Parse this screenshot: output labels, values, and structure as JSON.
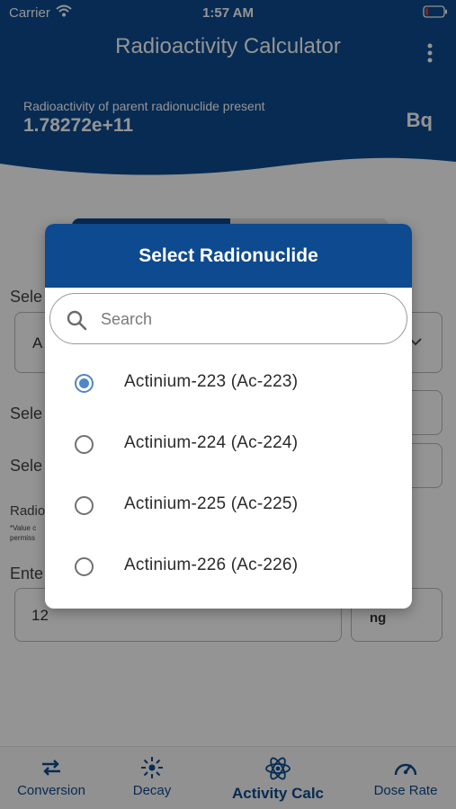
{
  "status_bar": {
    "carrier": "Carrier",
    "time": "1:57 AM"
  },
  "header": {
    "title": "Radioactivity Calculator",
    "result_label": "Radioactivity of parent radionuclide present",
    "result_value": "1.78272e+11",
    "result_unit": "Bq"
  },
  "background_form": {
    "label_1": "Sele",
    "field_1_value": "A",
    "label_2": "Sele",
    "label_3": "Sele",
    "radio_label": "Radio",
    "note_line1": "*Value c",
    "note_line2": "permiss",
    "enter_label": "Ente",
    "amount_value": "12",
    "unit_value": "ng"
  },
  "dialog": {
    "title": "Select Radionuclide",
    "search_placeholder": "Search",
    "options": [
      {
        "label": "Actinium-223 (Ac-223)",
        "selected": true
      },
      {
        "label": "Actinium-224 (Ac-224)",
        "selected": false
      },
      {
        "label": "Actinium-225 (Ac-225)",
        "selected": false
      },
      {
        "label": "Actinium-226 (Ac-226)",
        "selected": false
      }
    ]
  },
  "tabbar": {
    "tabs": [
      {
        "label": "Conversion",
        "icon": "swap-arrows-icon",
        "active": false
      },
      {
        "label": "Decay",
        "icon": "radiation-burst-icon",
        "active": false
      },
      {
        "label": "Activity Calc",
        "icon": "atom-icon",
        "active": true
      },
      {
        "label": "Dose Rate",
        "icon": "gauge-icon",
        "active": false
      }
    ]
  },
  "colors": {
    "primary": "#0d4a8f",
    "radio_selected": "#4f86c6",
    "overlay": "rgba(0,0,0,0.42)"
  }
}
